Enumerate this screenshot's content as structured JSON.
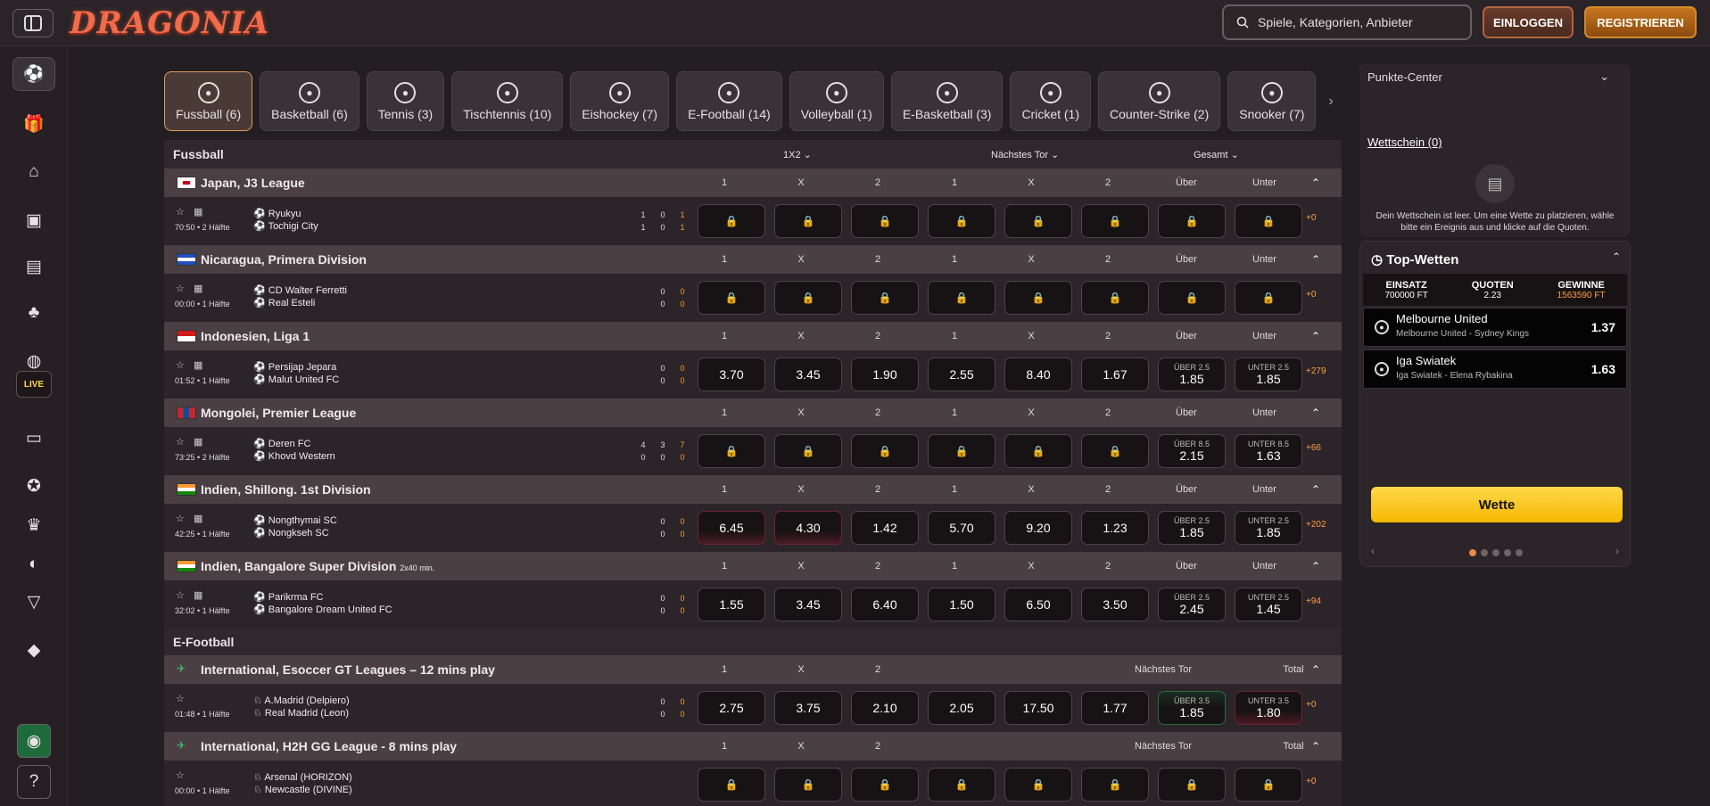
{
  "header": {
    "logo": "DRAGONIA",
    "search_placeholder": "Spiele, Kategorien, Anbieter",
    "login": "EINLOGGEN",
    "register": "REGISTRIEREN"
  },
  "sidebar": {
    "live_label": "LIVE"
  },
  "tabs": [
    {
      "label": "Fussball (6)",
      "icon": "football-icon"
    },
    {
      "label": "Basketball (6)",
      "icon": "basketball-icon"
    },
    {
      "label": "Tennis (3)",
      "icon": "tennis-icon"
    },
    {
      "label": "Tischtennis (10)",
      "icon": "table-tennis-icon"
    },
    {
      "label": "Eishockey (7)",
      "icon": "ice-hockey-icon"
    },
    {
      "label": "E-Football (14)",
      "icon": "e-football-icon"
    },
    {
      "label": "Volleyball (1)",
      "icon": "volleyball-icon"
    },
    {
      "label": "E-Basketball (3)",
      "icon": "e-basketball-icon"
    },
    {
      "label": "Cricket (1)",
      "icon": "cricket-icon"
    },
    {
      "label": "Counter-Strike (2)",
      "icon": "counter-strike-icon"
    },
    {
      "label": "Snooker (7)",
      "icon": "snooker-icon"
    }
  ],
  "sections": {
    "fussball": {
      "title": "Fussball",
      "m1": "1X2",
      "m2": "Nächstes Tor",
      "m3": "Gesamt"
    },
    "efootball": {
      "title": "E-Football"
    }
  },
  "col_labels": {
    "c1": "1",
    "cx": "X",
    "c2": "2",
    "over": "Über",
    "under": "Unter",
    "next_goal": "Nächstes Tor",
    "total": "Total"
  },
  "leagues": [
    {
      "name": "Japan, J3 League",
      "time": "70:50 • 2 Hälfte",
      "home": "Ryukyu",
      "away": "Tochigi City",
      "hs": [
        "1",
        "0",
        "1"
      ],
      "as": [
        "1",
        "0",
        "1"
      ],
      "odds": [
        "",
        "",
        "",
        "",
        "",
        "",
        "",
        ""
      ],
      "more": "+0"
    },
    {
      "name": "Nicaragua, Primera Division",
      "time": "00:00 • 1 Hälfte",
      "home": "CD Walter Ferretti",
      "away": "Real Esteli",
      "hs": [
        "0",
        "0"
      ],
      "as": [
        "0",
        "0"
      ],
      "odds": [
        "",
        "",
        "",
        "",
        "",
        "",
        "",
        ""
      ],
      "more": "+0"
    },
    {
      "name": "Indonesien, Liga 1",
      "time": "01:52 • 1 Hälfte",
      "home": "Persijap Jepara",
      "away": "Malut United FC",
      "hs": [
        "0",
        "0"
      ],
      "as": [
        "0",
        "0"
      ],
      "odds": [
        "3.70",
        "3.45",
        "1.90",
        "2.55",
        "8.40",
        "1.67",
        "1.85",
        "1.85"
      ],
      "ou_over": "ÜBER 2.5",
      "ou_under": "UNTER 2.5",
      "more": "+279"
    },
    {
      "name": "Mongolei, Premier League",
      "time": "73:25 • 2 Hälfte",
      "home": "Deren FC",
      "away": "Khovd Western",
      "hs": [
        "4",
        "3",
        "7"
      ],
      "as": [
        "0",
        "0",
        "0"
      ],
      "odds": [
        "",
        "",
        "",
        "",
        "",
        "",
        "2.15",
        "1.63"
      ],
      "ou_over": "ÜBER 8.5",
      "ou_under": "UNTER 8.5",
      "more": "+66"
    },
    {
      "name": "Indien, Shillong. 1st Division",
      "time": "42:25 • 1 Hälfte",
      "home": "Nongthymai SC",
      "away": "Nongkseh SC",
      "hs": [
        "0",
        "0"
      ],
      "as": [
        "0",
        "0"
      ],
      "odds": [
        "6.45",
        "4.30",
        "1.42",
        "5.70",
        "9.20",
        "1.23",
        "1.85",
        "1.85"
      ],
      "ou_over": "ÜBER 2.5",
      "ou_under": "UNTER 2.5",
      "more": "+202"
    },
    {
      "name": "Indien, Bangalore Super Division",
      "suffix": "2x40 min.",
      "time": "32:02 • 1 Hälfte",
      "home": "Parikrma FC",
      "away": "Bangalore Dream United FC",
      "hs": [
        "0",
        "0"
      ],
      "as": [
        "0",
        "0"
      ],
      "odds": [
        "1.55",
        "3.45",
        "6.40",
        "1.50",
        "6.50",
        "3.50",
        "2.45",
        "1.45"
      ],
      "ou_over": "ÜBER 2.5",
      "ou_under": "UNTER 2.5",
      "more": "+94"
    },
    {
      "name": "International, Esoccer GT Leagues – 12 mins play",
      "time": "01:48 • 1 Hälfte",
      "home": "A.Madrid (Delpiero)",
      "away": "Real Madrid (Leon)",
      "hs": [
        "0",
        "0"
      ],
      "as": [
        "0",
        "0"
      ],
      "odds": [
        "2.75",
        "3.75",
        "2.10",
        "2.05",
        "17.50",
        "1.77",
        "1.85",
        "1.80"
      ],
      "ou_over": "ÜBER 3.5",
      "ou_under": "UNTER 3.5",
      "more": "+0"
    },
    {
      "name": "International, H2H GG League - 8 mins play",
      "time": "00:00 • 1 Hälfte",
      "home": "Arsenal (HORIZON)",
      "away": "Newcastle (DIVINE)",
      "hs": [],
      "as": [],
      "odds": [
        "",
        "",
        "",
        "",
        "",
        "",
        "",
        ""
      ],
      "more": "+0"
    }
  ],
  "right": {
    "punkte": "Punkte-Center",
    "slip_title": "Wettschein (0)",
    "slip_msg": "Dein Wettschein ist leer. Um eine Wette zu platzieren, wähle bitte ein Ereignis aus und klicke auf die Quoten.",
    "top_title": "Top-Wetten",
    "einsatz_label": "EINSATZ",
    "einsatz": "700000 FT",
    "quoten_label": "QUOTEN",
    "quoten": "2.23",
    "gewinne_label": "GEWINNE",
    "gewinne": "1563590 FT",
    "picks": [
      {
        "name": "Melbourne United",
        "sub": "Melbourne United - Sydney Kings",
        "odd": "1.37"
      },
      {
        "name": "Iga Swiatek",
        "sub": "Iga Swiatek - Elena Rybakina",
        "odd": "1.63"
      }
    ],
    "bet_label": "Wette"
  }
}
